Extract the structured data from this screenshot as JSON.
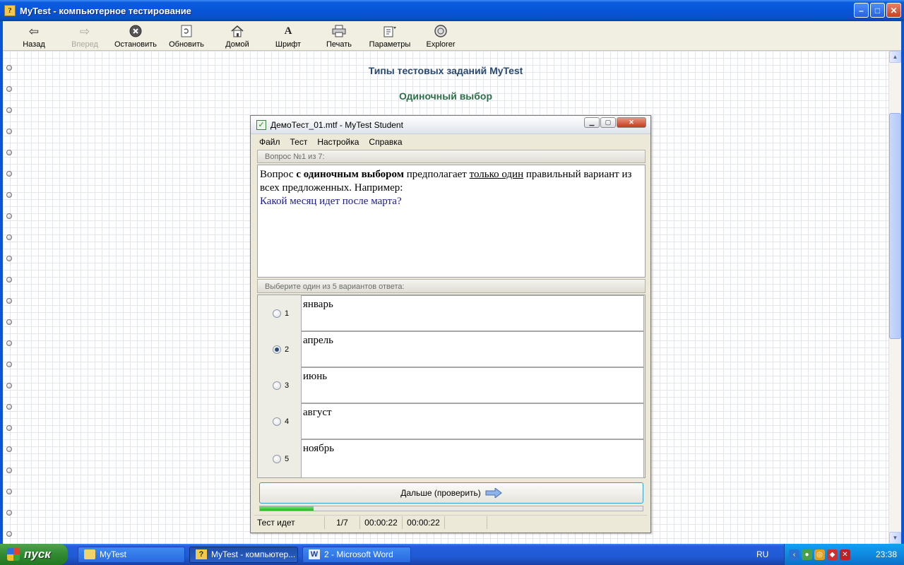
{
  "window": {
    "title": "MyTest - компьютерное тестирование",
    "controls": [
      "minimize",
      "maximize",
      "close"
    ]
  },
  "toolbar": {
    "buttons": [
      {
        "label": "Назад",
        "icon": "back-arrow-icon",
        "enabled": true
      },
      {
        "label": "Вперед",
        "icon": "forward-arrow-icon",
        "enabled": false
      },
      {
        "label": "Остановить",
        "icon": "stop-icon",
        "enabled": true
      },
      {
        "label": "Обновить",
        "icon": "refresh-icon",
        "enabled": true
      },
      {
        "label": "Домой",
        "icon": "home-icon",
        "enabled": true
      },
      {
        "label": "Шрифт",
        "icon": "font-icon",
        "enabled": true
      },
      {
        "label": "Печать",
        "icon": "print-icon",
        "enabled": true
      },
      {
        "label": "Параметры",
        "icon": "settings-icon",
        "enabled": true
      },
      {
        "label": "Explorer",
        "icon": "explorer-icon",
        "enabled": true
      }
    ]
  },
  "page": {
    "heading": "Типы тестовых заданий MyTest",
    "subheading": "Одиночный выбор"
  },
  "student_window": {
    "title": "ДемоТест_01.mtf - MyTest Student",
    "menu": [
      "Файл",
      "Тест",
      "Настройка",
      "Справка"
    ],
    "question_header": "Вопрос №1 из 7:",
    "question": {
      "part1": "Вопрос ",
      "bold": "с одиночным выбором",
      "part2": " предполагает ",
      "underline": "только один",
      "part3": " правильный вариант из всех предложенных. Например:",
      "example": "Какой месяц идет после марта?"
    },
    "answers_header": "Выберите один из 5 вариантов ответа:",
    "answers": [
      {
        "num": "1",
        "text": "январь",
        "selected": false
      },
      {
        "num": "2",
        "text": "апрель",
        "selected": true
      },
      {
        "num": "3",
        "text": "июнь",
        "selected": false
      },
      {
        "num": "4",
        "text": "август",
        "selected": false
      },
      {
        "num": "5",
        "text": "ноябрь",
        "selected": false
      }
    ],
    "next_button": "Дальше (проверить)",
    "progress_fraction": 0.14,
    "status": {
      "state": "Тест идет",
      "counter": "1/7",
      "time1": "00:00:22",
      "time2": "00:00:22"
    }
  },
  "taskbar": {
    "start": "пуск",
    "tasks": [
      {
        "label": "MyTest",
        "icon": "folder-icon",
        "active": false
      },
      {
        "label": "MyTest - компьютер...",
        "icon": "mytest-app-icon",
        "active": true
      },
      {
        "label": "2 - Microsoft Word",
        "icon": "word-icon",
        "active": false
      }
    ],
    "language": "RU",
    "clock": "23:38"
  },
  "colors": {
    "titlebar": "#0854d6",
    "heading": "#2b4a6f",
    "subheading": "#2f6e4a",
    "progress": "#28b428",
    "example_text": "#1a1a8c"
  }
}
